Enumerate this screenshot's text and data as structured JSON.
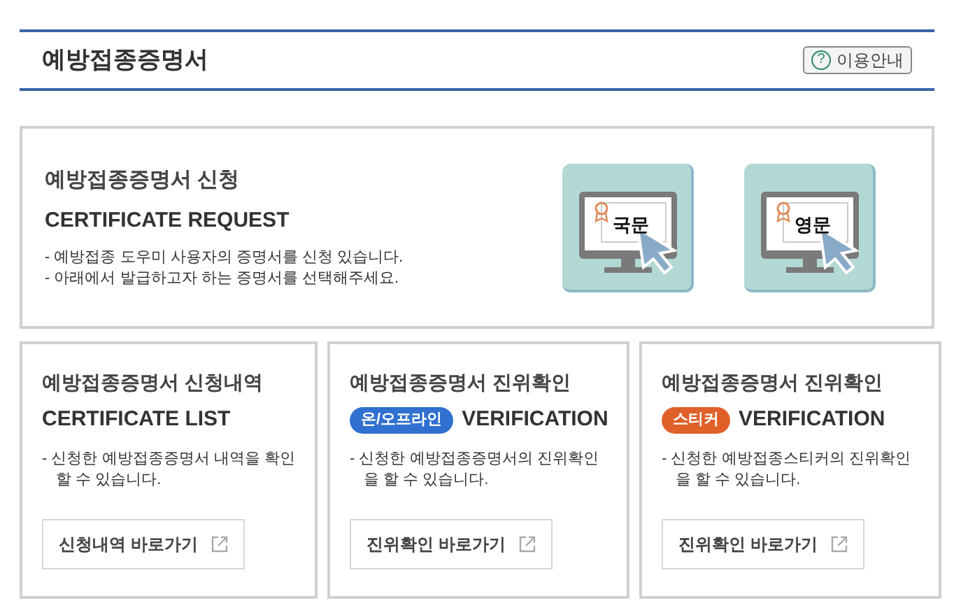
{
  "page_title": "예방접종증명서",
  "help_button": {
    "icon": "?",
    "label": "이용안내"
  },
  "request": {
    "title": "예방접종증명서 신청",
    "subtitle": "CERTIFICATE REQUEST",
    "notes": [
      "- 예방접종 도우미 사용자의 증명서를 신청 있습니다.",
      "- 아래에서 발급하고자 하는 증명서를 선택해주세요."
    ],
    "options": [
      {
        "label": "국문"
      },
      {
        "label": "영문"
      }
    ]
  },
  "cards": [
    {
      "title": "예방접종증명서 신청내역",
      "subtitle": "CERTIFICATE LIST",
      "note": "- 신청한 예방접종증명서 내역을 확인할 수 있습니다.",
      "link": "신청내역 바로가기"
    },
    {
      "title": "예방접종증명서 진위확인",
      "badge": {
        "label": "온/오프라인",
        "color": "#3070d0"
      },
      "subtitle": "VERIFICATION",
      "note": "- 신청한 예방접종증명서의 진위확인을 할 수 있습니다.",
      "link": "진위확인 바로가기"
    },
    {
      "title": "예방접종증명서 진위확인",
      "badge": {
        "label": "스티커",
        "color": "#e0602a"
      },
      "subtitle": "VERIFICATION",
      "note": "- 신청한 예방접종스티커의 진위확인을 할 수 있습니다.",
      "link": "진위확인 바로가기"
    }
  ]
}
